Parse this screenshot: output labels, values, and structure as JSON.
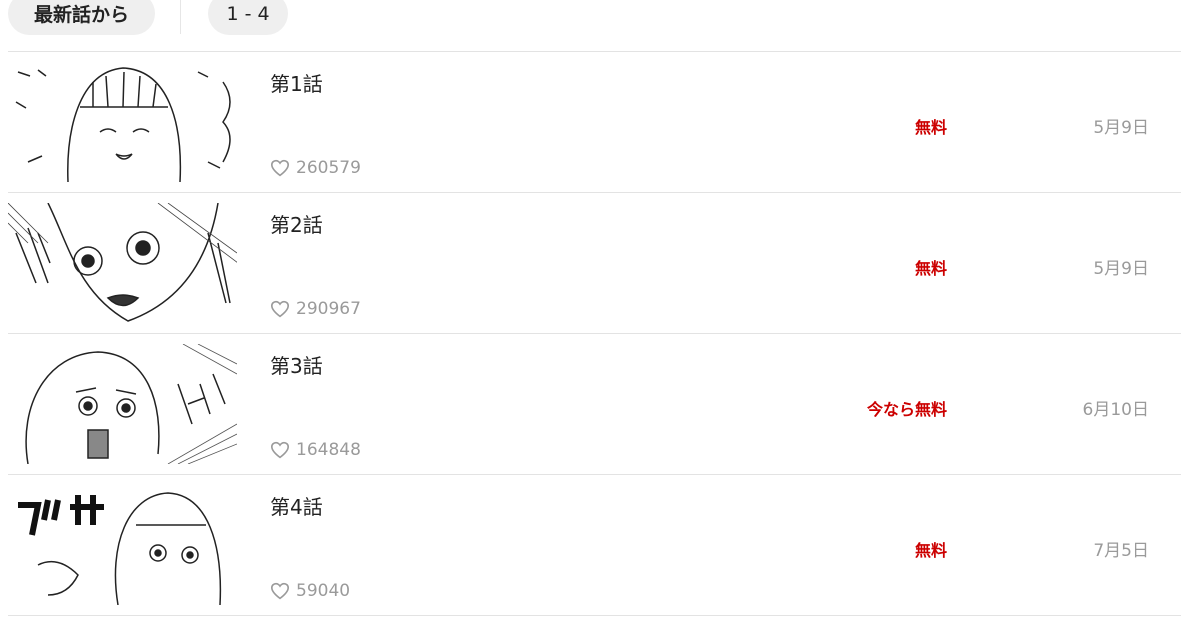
{
  "header": {
    "sort_label": "最新話から",
    "range_label": "1 - 4"
  },
  "colors": {
    "price": "#cc0000",
    "muted": "#9a9a9a",
    "pill_bg": "#efefef",
    "divider": "#e3e3e3"
  },
  "episodes": [
    {
      "title": "第1話",
      "likes": "260579",
      "price": "無料",
      "date": "5月9日",
      "thumbnail_icon": "manga-panel-image"
    },
    {
      "title": "第2話",
      "likes": "290967",
      "price": "無料",
      "date": "5月9日",
      "thumbnail_icon": "manga-panel-image"
    },
    {
      "title": "第3話",
      "likes": "164848",
      "price": "今なら無料",
      "date": "6月10日",
      "thumbnail_icon": "manga-panel-image"
    },
    {
      "title": "第4話",
      "likes": "59040",
      "price": "無料",
      "date": "7月5日",
      "thumbnail_icon": "manga-panel-image"
    }
  ],
  "icons": {
    "like": "heart-icon"
  }
}
